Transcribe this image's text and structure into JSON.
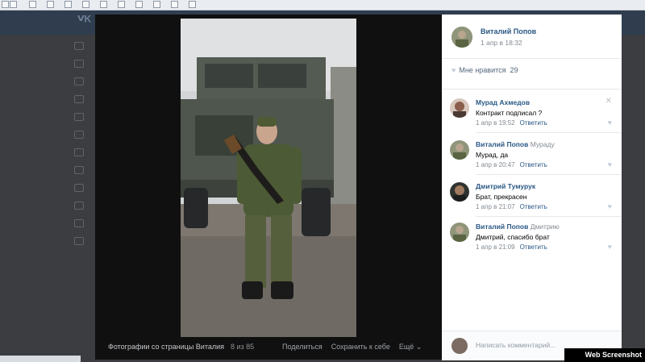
{
  "viewer": {
    "caption_title": "Фотографии со страницы Виталия",
    "counter": "8 из 85",
    "actions": [
      "Поделиться",
      "Сохранить к себе",
      "Ещё ⌄"
    ]
  },
  "panel": {
    "owner": {
      "name": "Виталий Попов",
      "date": "1 апр в 18:32"
    },
    "likes": {
      "label": "Мне нравится",
      "count": "29"
    },
    "comments": [
      {
        "name": "Мурад Ахмедов",
        "reply_to": "",
        "text": "Контракт подписал ?",
        "date": "1 апр в 19:52",
        "reply_label": "Ответить"
      },
      {
        "name": "Виталий Попов",
        "reply_to": "Мураду",
        "text": "Мурад, да",
        "date": "1 апр в 20:47",
        "reply_label": "Ответить"
      },
      {
        "name": "Дмитрий Тумурук",
        "reply_to": "",
        "text": "Брат, прекрасен",
        "date": "1 апр в 21:07",
        "reply_label": "Ответить"
      },
      {
        "name": "Виталий Попов",
        "reply_to": "Дмитрию",
        "text": "Дмитрий, спасибо брат",
        "date": "1 апр в 21:09",
        "reply_label": "Ответить"
      }
    ],
    "comment_placeholder": "Написать комментарий..."
  },
  "watermark": "Web Screenshot"
}
